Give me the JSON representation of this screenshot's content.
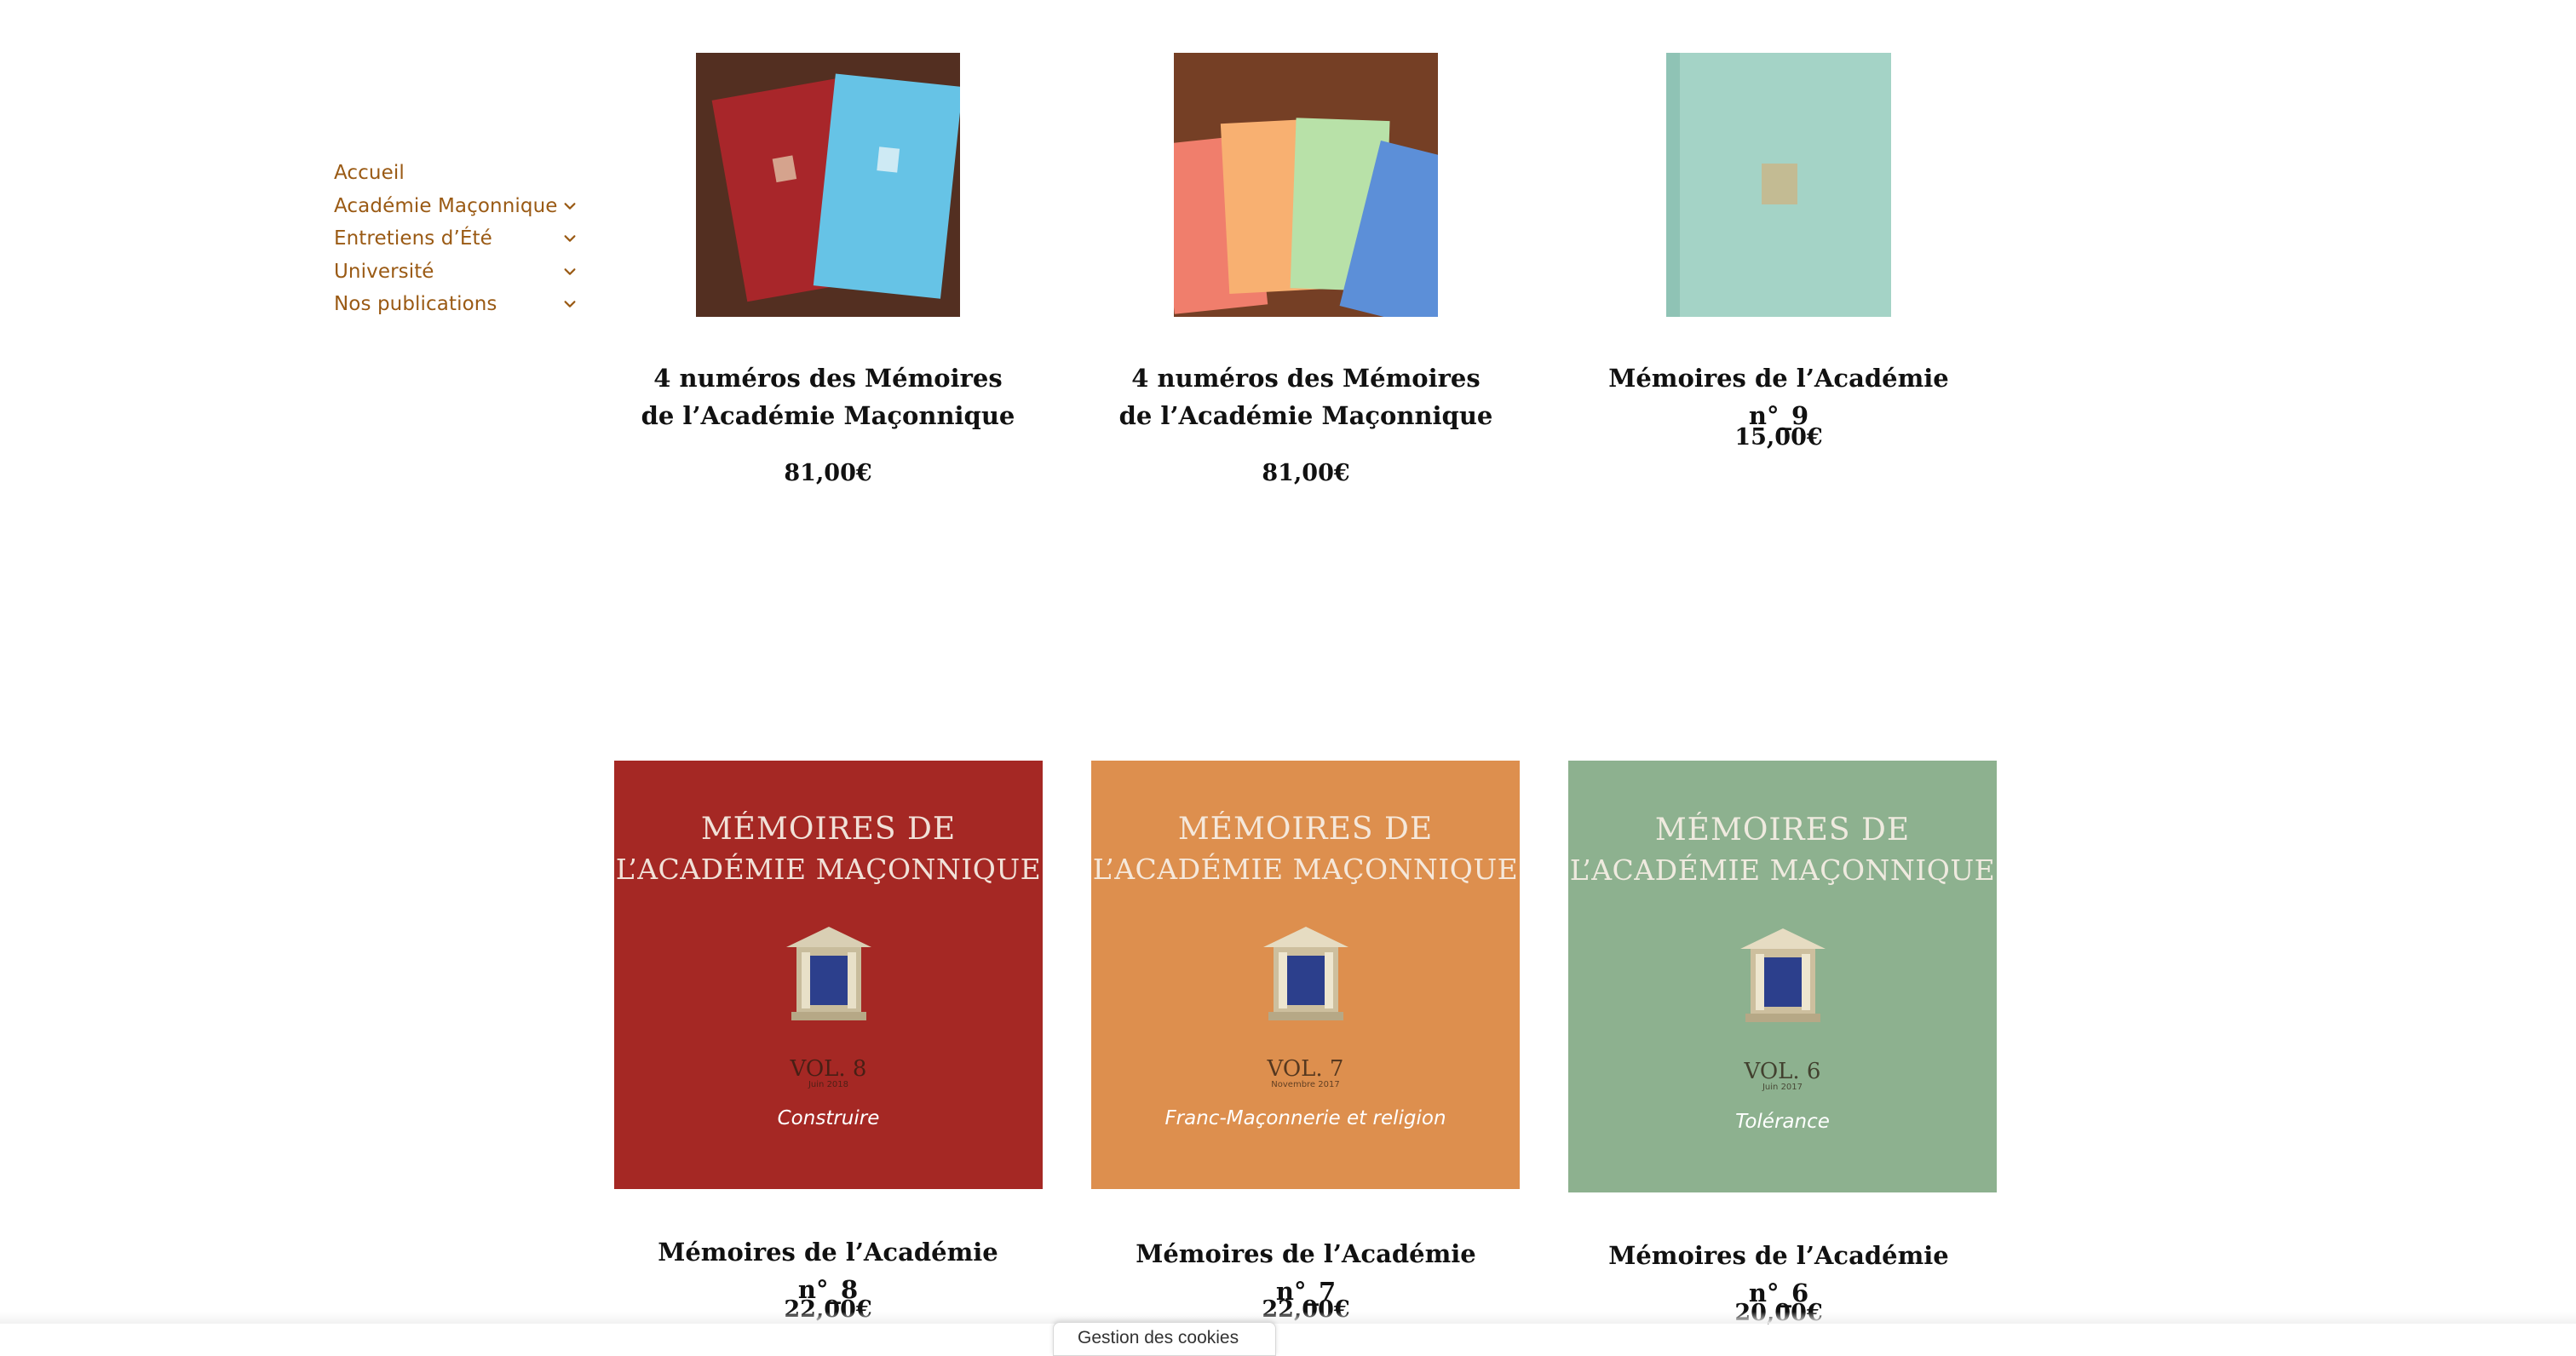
{
  "nav": {
    "items": [
      {
        "label": "Accueil",
        "has_submenu": false
      },
      {
        "label": "Académie Maçonnique",
        "has_submenu": true
      },
      {
        "label": "Entretiens d’Été",
        "has_submenu": true
      },
      {
        "label": "Université",
        "has_submenu": true
      },
      {
        "label": "Nos publications",
        "has_submenu": true
      }
    ],
    "color": "#9a5a14"
  },
  "products": [
    {
      "title": "4 numéros des Mémoires de l’Académie Maçonnique",
      "price": "81,00€"
    },
    {
      "title": "4 numéros des Mémoires de l’Académie Maçonnique",
      "price": "81,00€"
    },
    {
      "title": "Mémoires de l’Académie n°_9",
      "price": "15,00€"
    },
    {
      "title": "Mémoires de l’Académie n°_8",
      "price": "22,00€",
      "cover": {
        "line1": "MÉMOIRES DE",
        "line2": "L’ACADÉMIE MAÇONNIQUE",
        "vol": "VOL. 8",
        "date": "Juin 2018",
        "theme": "Construire",
        "color": "#a52824"
      }
    },
    {
      "title": "Mémoires de l’Académie n°_7",
      "price": "22,00€",
      "cover": {
        "line1": "MÉMOIRES DE",
        "line2": "L’ACADÉMIE MAÇONNIQUE",
        "vol": "VOL. 7",
        "date": "Novembre 2017",
        "theme": "Franc-Maçonnerie et religion",
        "color": "#dd8f4e"
      }
    },
    {
      "title": "Mémoires de l’Académie n°_6",
      "price": "20,00€",
      "cover": {
        "line1": "MÉMOIRES DE",
        "line2": "L’ACADÉMIE MAÇONNIQUE",
        "vol": "VOL. 6",
        "date": "Juin 2017",
        "theme": "Tolérance",
        "color": "#8db18f"
      }
    }
  ],
  "consent_label": "Gestion des cookies"
}
